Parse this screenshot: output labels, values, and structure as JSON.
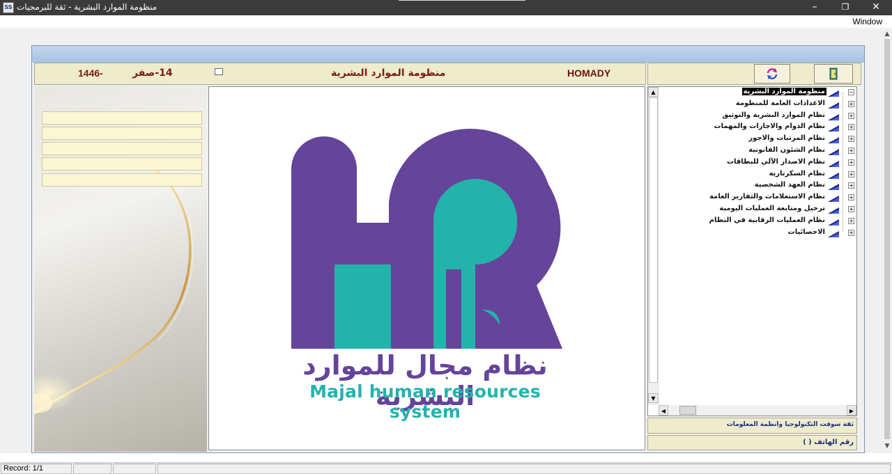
{
  "window": {
    "title": "منظومة الموارد البشرية - ثقة للبرمجيات",
    "icon": "app-icon",
    "icon_text": "SS",
    "controls": {
      "minimize": "–",
      "restore": "❐",
      "close": "✕"
    }
  },
  "menu": {
    "window_label": "Window"
  },
  "header": {
    "year": "1446-",
    "day": "14-صفر",
    "system_title": "منظومة الموارد البشرية",
    "user": "HOMADY"
  },
  "toolbar": {
    "refresh_icon": "refresh-icon",
    "exit_icon": "exit-door-icon"
  },
  "logo": {
    "arabic_text": "نظام مجال للموارد البشرية",
    "english_text": "Majal human resources system",
    "colors": {
      "purple": "#65449a",
      "teal": "#23b3ab"
    }
  },
  "tree": {
    "items": [
      {
        "label": "منظومة الموارد البشرية",
        "expanded": true
      },
      {
        "label": "الاعدادات العامة للمنظومة"
      },
      {
        "label": "نظام الموارد البشرية والتوثيق"
      },
      {
        "label": "نظام الدوام والاجازات والمهمات"
      },
      {
        "label": "نظام المرتبات والاجور"
      },
      {
        "label": "نظام الشئون القانونية"
      },
      {
        "label": "نظام الاصدار الآلي للبطاقات"
      },
      {
        "label": "نظام السكرتارية"
      },
      {
        "label": "نظام العهد الشخصية"
      },
      {
        "label": "نظام الاستعلامات والتقارير العامة"
      },
      {
        "label": "ترحيل ومتابعة العمليات اليومية"
      },
      {
        "label": "نظام العمليات الرقابية في النظام"
      },
      {
        "label": "الاحصائيات"
      }
    ]
  },
  "company": "ثقة سوفت التكنولوجيا وانظمة المعلومات",
  "phone": "رقم الهاتف (    )",
  "status": {
    "record": "Record: 1/1"
  }
}
